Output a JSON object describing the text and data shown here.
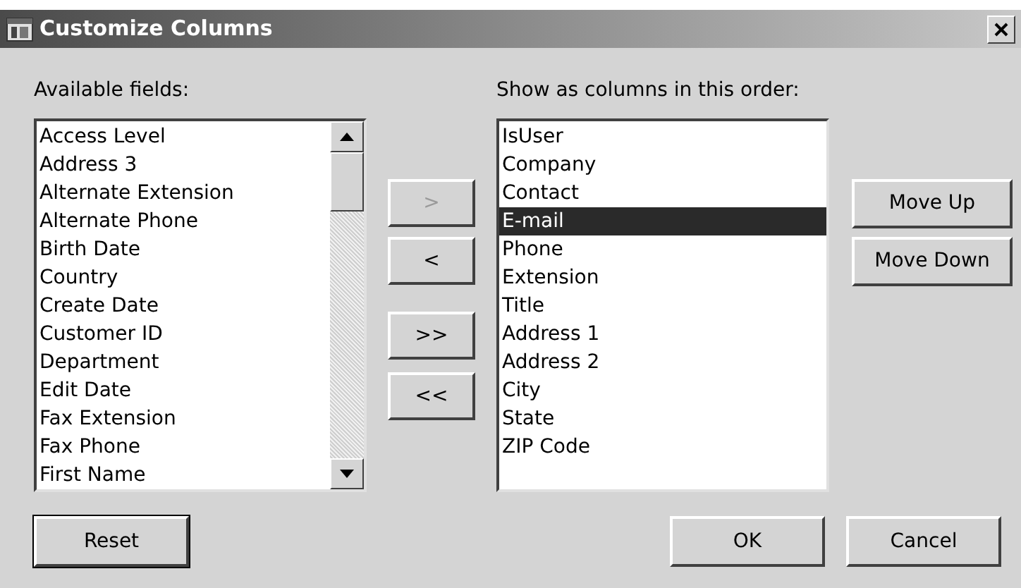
{
  "window": {
    "title": "Customize Columns"
  },
  "available": {
    "label": "Available fields:",
    "items": [
      {
        "text": "Access Level",
        "selected": false
      },
      {
        "text": "Address 3",
        "selected": false
      },
      {
        "text": "Alternate Extension",
        "selected": false
      },
      {
        "text": "Alternate Phone",
        "selected": false
      },
      {
        "text": "Birth Date",
        "selected": false
      },
      {
        "text": "Country",
        "selected": false
      },
      {
        "text": "Create Date",
        "selected": false
      },
      {
        "text": "Customer ID",
        "selected": false
      },
      {
        "text": "Department",
        "selected": false
      },
      {
        "text": "Edit Date",
        "selected": false
      },
      {
        "text": "Fax Extension",
        "selected": false
      },
      {
        "text": "Fax Phone",
        "selected": false
      },
      {
        "text": "First Name",
        "selected": false
      }
    ]
  },
  "transfer_buttons": [
    {
      "label": ">",
      "disabled": true
    },
    {
      "label": "<",
      "disabled": false
    },
    {
      "label": ">>",
      "disabled": false
    },
    {
      "label": "<<",
      "disabled": false
    }
  ],
  "columns": {
    "label": "Show as columns in this order:",
    "items": [
      {
        "text": "IsUser",
        "selected": false
      },
      {
        "text": "Company",
        "selected": false
      },
      {
        "text": "Contact",
        "selected": false
      },
      {
        "text": "E-mail",
        "selected": true
      },
      {
        "text": "Phone",
        "selected": false
      },
      {
        "text": "Extension",
        "selected": false
      },
      {
        "text": "Title",
        "selected": false
      },
      {
        "text": "Address 1",
        "selected": false
      },
      {
        "text": "Address 2",
        "selected": false
      },
      {
        "text": "City",
        "selected": false
      },
      {
        "text": "State",
        "selected": false
      },
      {
        "text": "ZIP Code",
        "selected": false
      }
    ]
  },
  "order_buttons": [
    {
      "label": "Move Up",
      "disabled": false
    },
    {
      "label": "Move Down",
      "disabled": false
    }
  ],
  "reset_button": {
    "label": "Reset",
    "default": true
  },
  "ok_button": {
    "label": "OK",
    "default": false
  },
  "cancel_button": {
    "label": "Cancel",
    "default": false
  }
}
